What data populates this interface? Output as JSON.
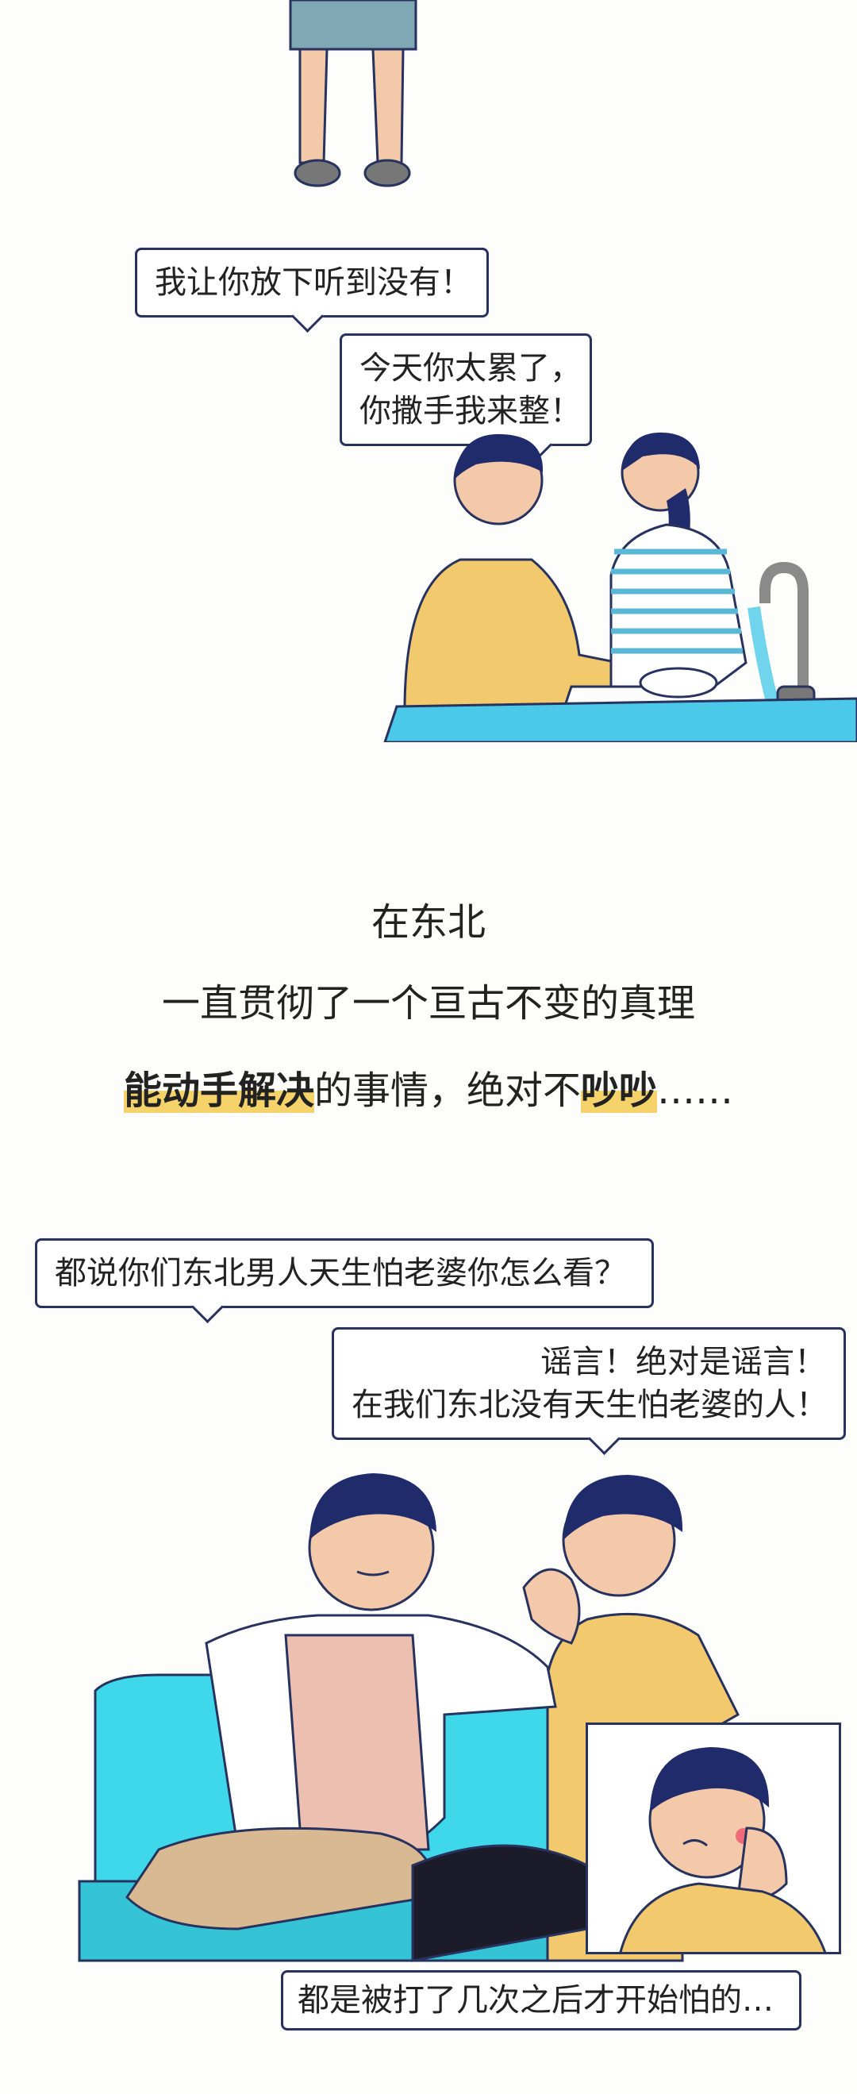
{
  "scene1": {
    "bubble1": "我让你放下听到没有！",
    "bubble2_line1": "今天你太累了，",
    "bubble2_line2": "你撒手我来整！"
  },
  "caption": {
    "line1": "在东北",
    "line2": "一直贯彻了一个亘古不变的真理",
    "line3_hl1": "能动手解决",
    "line3_mid": "的事情，绝对不",
    "line3_hl2": "吵吵",
    "line3_end": "……"
  },
  "scene2": {
    "question": "都说你们东北男人天生怕老婆你怎么看？",
    "answer_line1": "谣言！绝对是谣言！",
    "answer_line2": "在我们东北没有天生怕老婆的人！",
    "inset_caption": "都是被打了几次之后才开始怕的…"
  },
  "colors": {
    "outline": "#27325e",
    "counter": "#4cc9e8",
    "sofa": "#3fd8ea",
    "shirt_yellow": "#f2c96c",
    "highlight": "#f6d36a"
  }
}
